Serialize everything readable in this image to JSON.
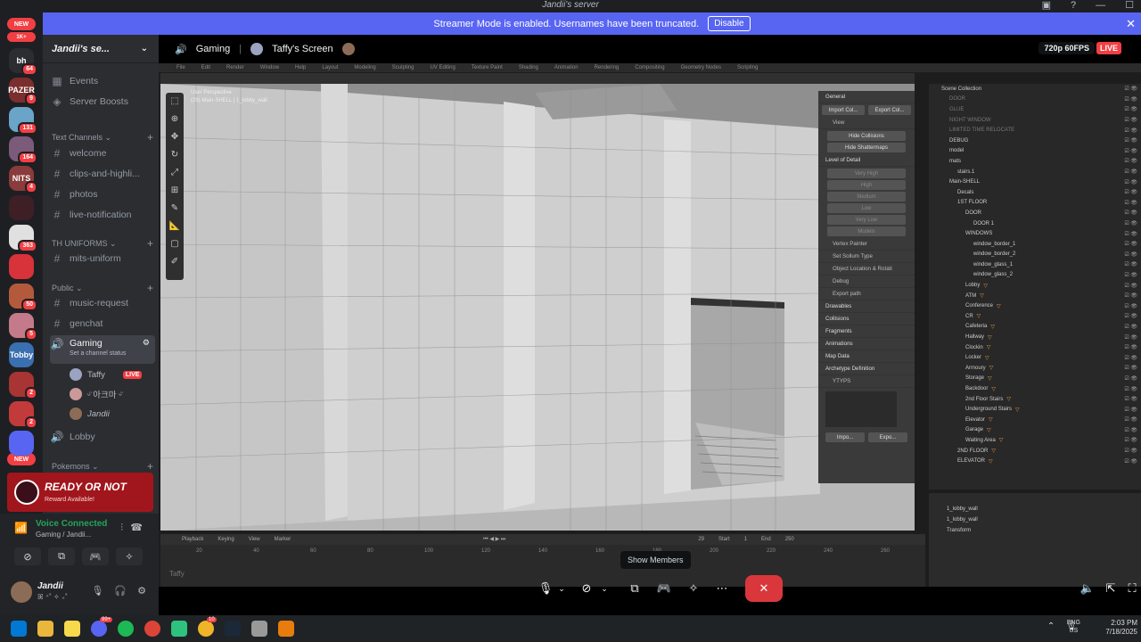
{
  "window": {
    "title": "Jandii's server"
  },
  "banner": {
    "text": "Streamer Mode is enabled. Usernames have been truncated.",
    "disable_label": "Disable"
  },
  "rail": {
    "new_top": "NEW",
    "badge_top": "1K+",
    "new_bottom": "NEW",
    "servers": [
      {
        "label": "bh",
        "badge": "64",
        "color": "#2b2d31"
      },
      {
        "label": "PAZER",
        "badge": "9",
        "color": "#7a2e2e"
      },
      {
        "label": "",
        "badge": "131",
        "color": "#6aa4c8"
      },
      {
        "label": "",
        "badge": "164",
        "color": "#7b5a7a"
      },
      {
        "label": "NITS",
        "badge": "4",
        "color": "#8a3b3b"
      },
      {
        "label": "",
        "badge": "",
        "color": "#3d1f25"
      },
      {
        "label": "",
        "badge": "363",
        "color": "#e0e0e0"
      },
      {
        "label": "",
        "badge": "",
        "color": "#d8323b"
      },
      {
        "label": "",
        "badge": "50",
        "color": "#b35a3c"
      },
      {
        "label": "",
        "badge": "5",
        "color": "#c47a8a"
      },
      {
        "label": "Tobby",
        "badge": "",
        "color": "#3a6fb0"
      },
      {
        "label": "",
        "badge": "2",
        "color": "#a83434"
      },
      {
        "label": "",
        "badge": "2",
        "color": "#c23a3a"
      },
      {
        "label": "",
        "badge": "",
        "color": "#5865f2"
      }
    ]
  },
  "sidebar": {
    "guild_name": "Jandii's se...",
    "events": "Events",
    "boosts": "Server Boosts",
    "cat_text": "Text Channels",
    "text_channels": [
      "welcome",
      "clips-and-highli...",
      "photos",
      "live-notification"
    ],
    "cat_uniforms": "TH UNIFORMS",
    "uniform_channels": [
      "mits-uniform"
    ],
    "cat_public": "Public",
    "public_channels": [
      "music-request",
      "genchat"
    ],
    "voice_channel": "Gaming",
    "voice_status": "Set a channel status",
    "voice_users": [
      {
        "name": "Taffy",
        "live": "LIVE"
      },
      {
        "name": "ᵕ̈ 아크마 ᵕ̈",
        "live": ""
      },
      {
        "name": "Jandii",
        "live": ""
      }
    ],
    "lobby": "Lobby",
    "cat_pokemons": "Pokemons"
  },
  "promo": {
    "title": "READY OR NOT",
    "subtitle": "Reward Available!"
  },
  "voice": {
    "connected": "Voice Connected",
    "subtext": "Gaming / Jandii..."
  },
  "user": {
    "name": "Jandii",
    "status": "ꕤ ⁺˚ ✧ ₊˚"
  },
  "stream": {
    "channel": "Gaming",
    "screen_label": "Taffy's Screen",
    "quality": "720p 60FPS",
    "live": "LIVE"
  },
  "blender": {
    "menu": [
      "File",
      "Edit",
      "Render",
      "Window",
      "Help",
      "Layout",
      "Modeling",
      "Sculpting",
      "UV Editing",
      "Texture Paint",
      "Shading",
      "Animation",
      "Rendering",
      "Compositing",
      "Geometry Nodes",
      "Scripting"
    ],
    "viewport_info": [
      "User Perspective",
      "(29) Main-SHELL | 1_lobby_wall"
    ],
    "npanel": {
      "header": "General",
      "tabs": [
        "Import Col...",
        "Export Col..."
      ],
      "view": "View",
      "buttons": [
        "Hide Collisions",
        "Hide Shattermaps"
      ],
      "lod": "Level of Detail",
      "lod_items": [
        "Very High",
        "High",
        "Medium",
        "Low",
        "Very Low",
        "Models"
      ],
      "rows": [
        "Vertex Painter",
        "Set Sollum Type",
        "Object Location & Rotati",
        "Debug",
        "Export path",
        "Drawables",
        "Collisions",
        "Fragments",
        "Animations",
        "Map Data",
        "Archetype Definition",
        "YTYPS"
      ],
      "footer": [
        "Impo...",
        "Expo..."
      ]
    },
    "outliner": [
      "Scene Collection",
      "DOOR",
      "GLUE",
      "NIGHT WINDOW",
      "LIMITED TIME RELOCATE",
      "DEBUG",
      "model",
      "mats",
      "stairs.1",
      "Main-SHELL",
      "Decals",
      "1ST FLOOR",
      "DOOR",
      "DOOR 1",
      "WINDOWS",
      "window_border_1",
      "window_border_2",
      "window_glass_1",
      "window_glass_2",
      "Lobby",
      "ATM",
      "Conference",
      "CR",
      "Cafeteria",
      "Hallway",
      "Clockin",
      "Locker",
      "Armoury",
      "Storage",
      "Backdoor",
      "2nd Floor Stairs",
      "Underground Stairs",
      "Elevator",
      "Garage",
      "Waiting Area",
      "2ND FLOOR",
      "ELEVATOR"
    ],
    "props": [
      "1_lobby_wall",
      "1_lobby_wall",
      "Transform"
    ],
    "timeline_bar": [
      "Playback",
      "Keying",
      "View",
      "Marker"
    ],
    "timeline_frame": "29",
    "timeline_start": "Start",
    "timeline_start_val": "1",
    "timeline_end": "End",
    "timeline_end_val": "250",
    "ruler": [
      "20",
      "40",
      "60",
      "80",
      "100",
      "120",
      "140",
      "160",
      "180",
      "200",
      "220",
      "240",
      "260"
    ],
    "search_hint": "Taffy"
  },
  "tooltip": {
    "show_members": "Show Members"
  },
  "taskbar": {
    "lang_top": "ENG",
    "lang_bottom": "US",
    "time": "2:03 PM",
    "date": "7/18/2025",
    "badges": [
      "99+",
      "10"
    ]
  }
}
